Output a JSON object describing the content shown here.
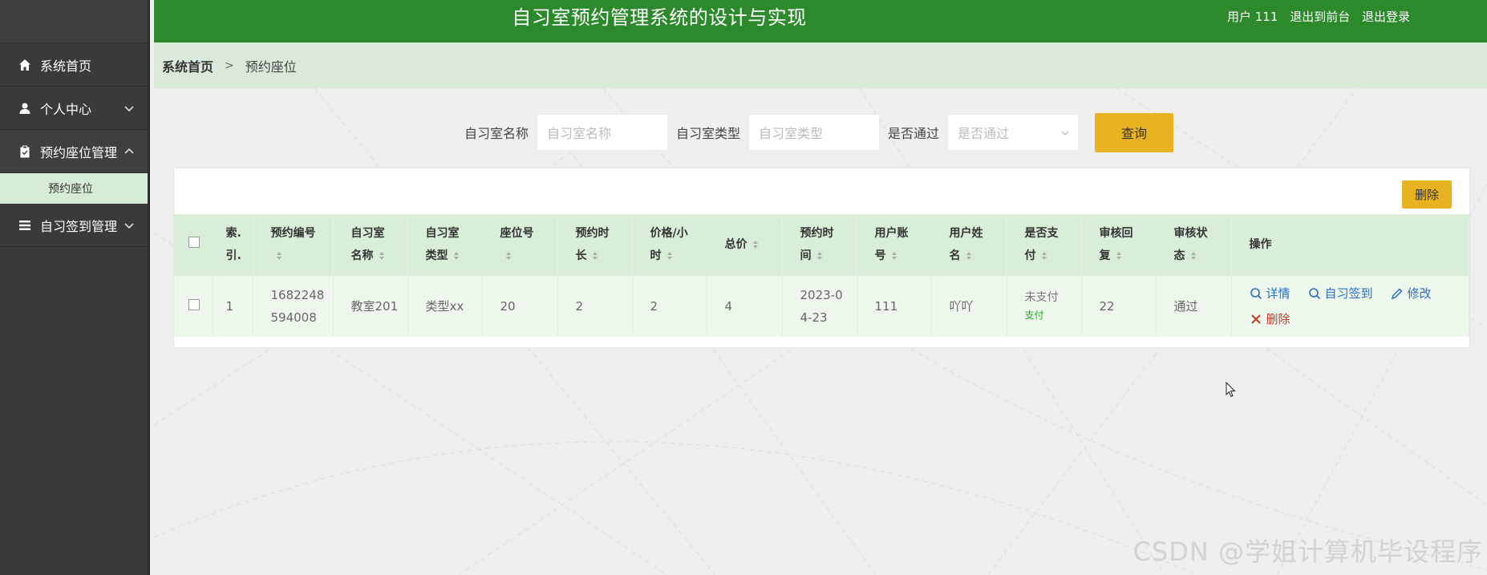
{
  "header": {
    "title": "自习室预约管理系统的设计与实现",
    "user_label": "用户 111",
    "front_link": "退出到前台",
    "logout_link": "退出登录"
  },
  "sidebar": {
    "items": [
      {
        "label": "系统首页",
        "icon": "home-icon"
      },
      {
        "label": "个人中心",
        "icon": "user-icon"
      },
      {
        "label": "预约座位管理",
        "icon": "clipboard-icon"
      },
      {
        "label": "自习签到管理",
        "icon": "list-icon"
      }
    ],
    "sub_item": "预约座位"
  },
  "breadcrumb": {
    "home": "系统首页",
    "separator": ">",
    "current": "预约座位"
  },
  "search": {
    "room_name_label": "自习室名称",
    "room_name_placeholder": "自习室名称",
    "room_type_label": "自习室类型",
    "room_type_placeholder": "自习室类型",
    "approved_label": "是否通过",
    "approved_placeholder": "是否通过",
    "query_button": "查询"
  },
  "toolbar": {
    "delete_button": "删除"
  },
  "table": {
    "columns": [
      {
        "key": "index",
        "line1": "索.",
        "line2": "引."
      },
      {
        "key": "booking_no",
        "line1": "预约编号",
        "line2": ""
      },
      {
        "key": "room_name",
        "line1": "自习室",
        "line2": "名称"
      },
      {
        "key": "room_type",
        "line1": "自习室",
        "line2": "类型"
      },
      {
        "key": "seat_no",
        "line1": "座位号",
        "line2": ""
      },
      {
        "key": "duration",
        "line1": "预约时",
        "line2": "长"
      },
      {
        "key": "price",
        "line1": "价格/小",
        "line2": "时"
      },
      {
        "key": "total",
        "line1": "总价",
        "line2": ""
      },
      {
        "key": "time",
        "line1": "预约时",
        "line2": "间"
      },
      {
        "key": "account",
        "line1": "用户账",
        "line2": "号"
      },
      {
        "key": "user_name",
        "line1": "用户姓",
        "line2": "名"
      },
      {
        "key": "paid",
        "line1": "是否支",
        "line2": "付"
      },
      {
        "key": "reply",
        "line1": "审核回",
        "line2": "复"
      },
      {
        "key": "audit",
        "line1": "审核状",
        "line2": "态"
      },
      {
        "key": "ops",
        "line1": "操作",
        "line2": ""
      }
    ],
    "rows": [
      {
        "index": "1",
        "booking_no_1": "1682248",
        "booking_no_2": "594008",
        "room_name": "教室201",
        "room_type": "类型xx",
        "seat_no": "20",
        "duration": "2",
        "price": "2",
        "total": "4",
        "time_1": "2023-0",
        "time_2": "4-23",
        "account": "111",
        "user_name": "吖吖",
        "paid_status": "未支付",
        "paid_action": "支付",
        "reply": "22",
        "audit": "通过",
        "actions": {
          "detail": "详情",
          "checkin": "自习签到",
          "edit": "修改",
          "delete": "删除"
        }
      }
    ]
  },
  "watermark": "CSDN @学姐计算机毕设程序",
  "colors": {
    "header_green": "#2c8a2c",
    "sidebar_dark": "#3a3a3a",
    "accent_yellow": "#e8b321",
    "table_header": "#d9eed9",
    "link_blue": "#2a6fbf",
    "danger_red": "#c0392b"
  }
}
